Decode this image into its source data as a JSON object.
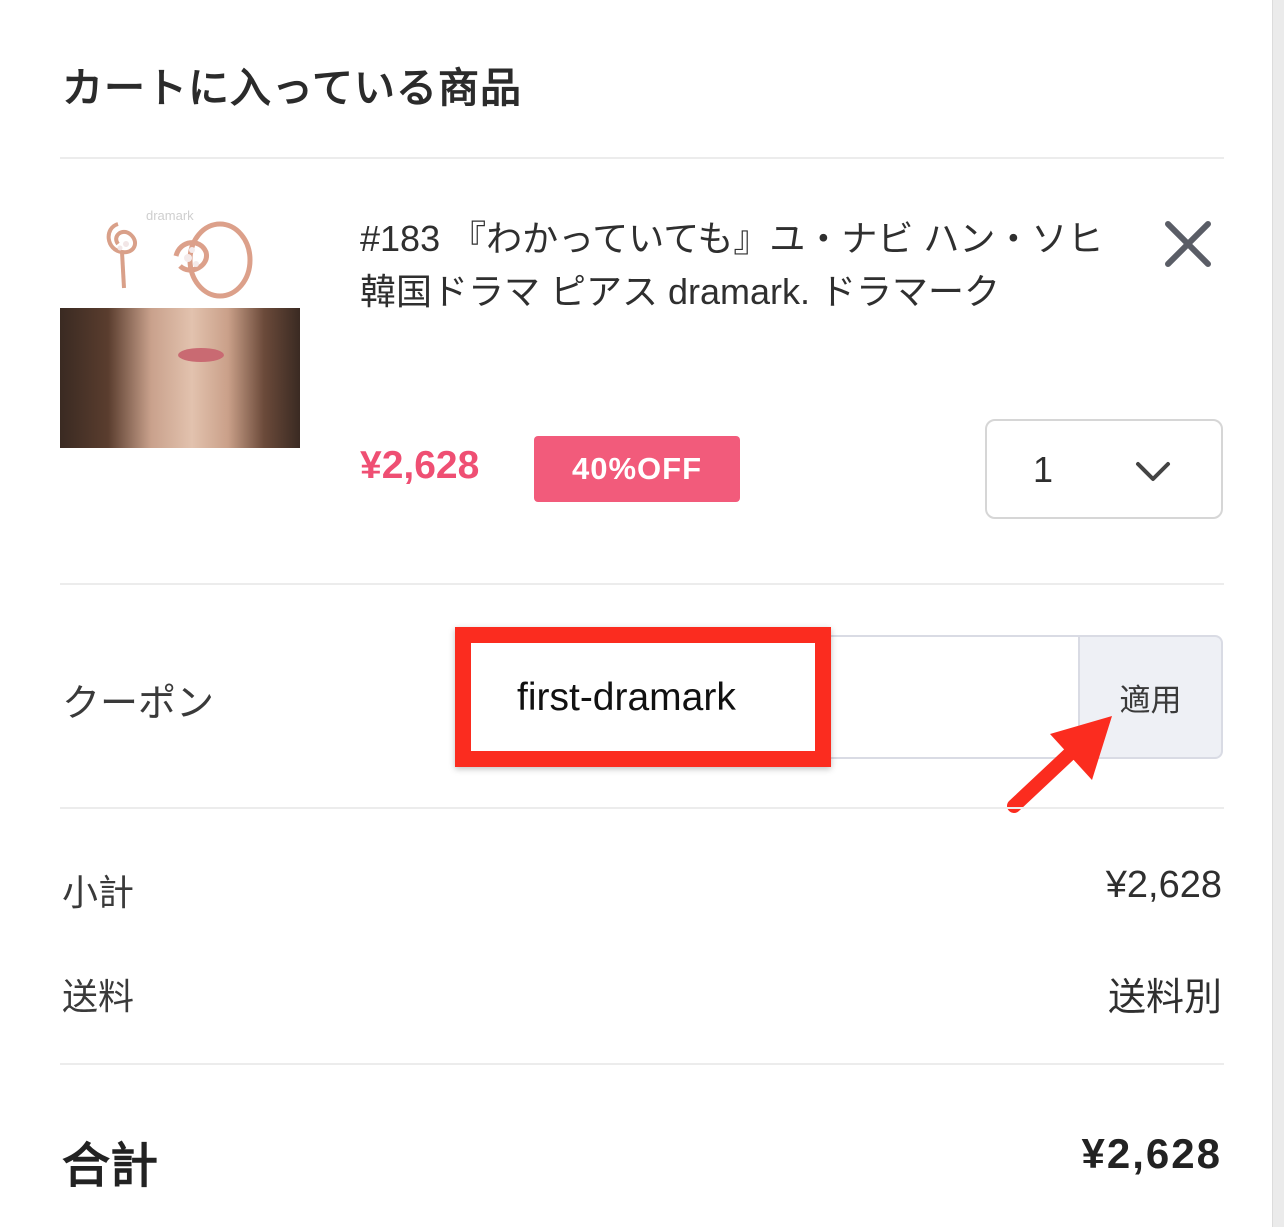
{
  "cart": {
    "title": "カートに入っている商品"
  },
  "item": {
    "name": "#183 『わかっていても』ユ・ナビ ハン・ソヒ 韓国ドラマ ピアス dramark. ドラマーク",
    "price": "¥2,628",
    "discount_badge": "40%OFF",
    "quantity": "1",
    "image_watermark": "dramark",
    "remove_icon": "close-icon"
  },
  "coupon": {
    "label": "クーポン",
    "value": "first-dramark",
    "apply_label": "適用"
  },
  "summary": {
    "subtotal_label": "小計",
    "subtotal_value": "¥2,628",
    "shipping_label": "送料",
    "shipping_value": "送料別",
    "total_label": "合計",
    "total_value": "¥2,628"
  },
  "colors": {
    "price": "#ef4f73",
    "badge": "#f25b7b",
    "annotation": "#fb2c1f"
  }
}
